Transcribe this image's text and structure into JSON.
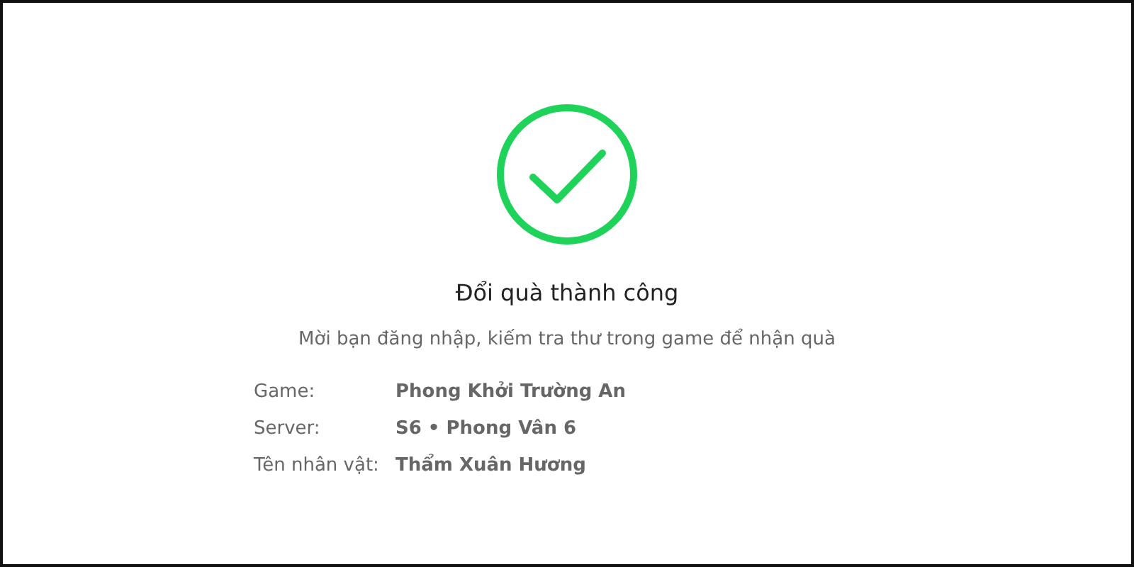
{
  "status": {
    "title": "Đổi quà thành công",
    "message": "Mời bạn đăng nhập, kiếm tra thư trong game để nhận quà"
  },
  "details": [
    {
      "label": "Game:",
      "value": "Phong Khởi Trường An"
    },
    {
      "label": "Server:",
      "value": "S6 • Phong Vân 6"
    },
    {
      "label": "Tên nhân vật:",
      "value": "Thẩm Xuân Hương"
    }
  ]
}
